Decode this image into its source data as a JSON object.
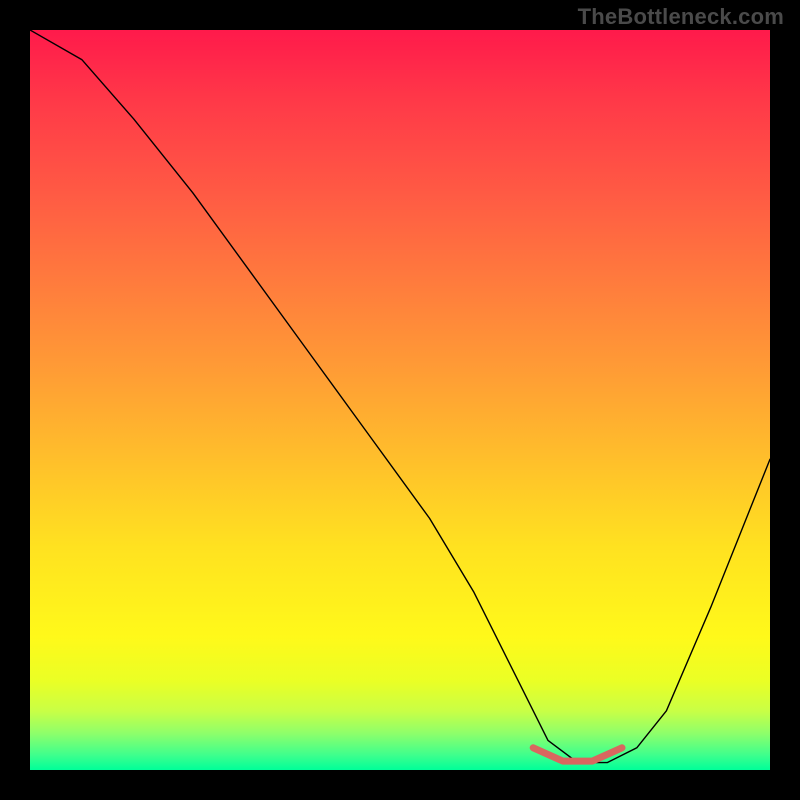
{
  "watermark": "TheBottleneck.com",
  "chart_data": {
    "type": "line",
    "title": "",
    "xlabel": "",
    "ylabel": "",
    "xlim": [
      0,
      100
    ],
    "ylim": [
      0,
      100
    ],
    "grid": false,
    "legend": false,
    "series": [
      {
        "name": "bottleneck-curve",
        "x": [
          0,
          7,
          14,
          22,
          30,
          38,
          46,
          54,
          60,
          66,
          70,
          74,
          78,
          82,
          86,
          92,
          96,
          100
        ],
        "values": [
          100,
          96,
          88,
          78,
          67,
          56,
          45,
          34,
          24,
          12,
          4,
          1,
          1,
          3,
          8,
          22,
          32,
          42
        ]
      }
    ],
    "highlight": {
      "name": "optimal-range",
      "x": [
        68,
        72,
        76,
        80
      ],
      "values": [
        3,
        1.2,
        1.2,
        3
      ],
      "color": "#d9675f"
    },
    "background_gradient": {
      "top": "#ff1a4b",
      "mid": "#ffe220",
      "bottom": "#00ff99"
    }
  }
}
